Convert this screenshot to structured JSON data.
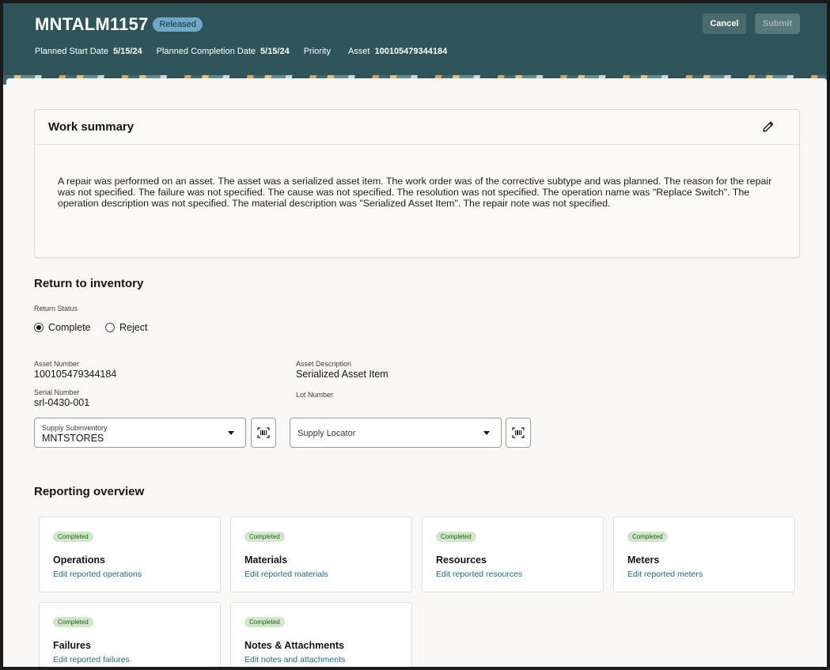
{
  "header": {
    "title": "MNTALM1157",
    "status": "Released",
    "meta": [
      {
        "label": "Planned Start Date",
        "value": "5/15/24"
      },
      {
        "label": "Planned Completion Date",
        "value": "5/15/24"
      },
      {
        "label": "Priority",
        "value": ""
      },
      {
        "label": "Asset",
        "value": "100105479344184"
      }
    ],
    "cancel_label": "Cancel",
    "submit_label": "Submit"
  },
  "summary": {
    "title": "Work summary",
    "edit_icon": "pencil-icon",
    "text": "A repair was performed on an asset. The asset was a serialized asset item. The work order was of the corrective subtype and was planned. The reason for the repair was not specified. The failure was not specified. The cause was not specified. The resolution was not specified. The operation name was \"Replace Switch\". The operation description was not specified. The material description was \"Serialized Asset Item\". The repair note was not specified."
  },
  "return_inventory": {
    "title": "Return to inventory",
    "status_label": "Return Status",
    "options": [
      {
        "label": "Complete",
        "selected": true
      },
      {
        "label": "Reject",
        "selected": false
      }
    ],
    "asset_number_label": "Asset Number",
    "asset_number": "100105479344184",
    "asset_description_label": "Asset Description",
    "asset_description": "Serialized Asset Item",
    "serial_number_label": "Serial Number",
    "serial_number": "srl-0430-001",
    "lot_number_label": "Lot Number",
    "supply_subinventory_label": "Supply Subinventory",
    "supply_subinventory": "MNTSTORES",
    "supply_locator_placeholder": "Supply Locator"
  },
  "reporting": {
    "title": "Reporting overview",
    "tiles": [
      {
        "status": "Completed",
        "title": "Operations",
        "link": "Edit reported operations"
      },
      {
        "status": "Completed",
        "title": "Materials",
        "link": "Edit reported materials"
      },
      {
        "status": "Completed",
        "title": "Resources",
        "link": "Edit reported resources"
      },
      {
        "status": "Completed",
        "title": "Meters",
        "link": "Edit reported meters"
      },
      {
        "status": "Completed",
        "title": "Failures",
        "link": "Edit reported failures"
      },
      {
        "status": "Completed",
        "title": "Notes & Attachments",
        "link": "Edit notes and attachments"
      }
    ]
  },
  "colors": {
    "header_bg": "#2f5459",
    "badge_bg": "#6fa8c4",
    "chip_bg": "#cfe8c9",
    "link": "#1e6a8f"
  }
}
